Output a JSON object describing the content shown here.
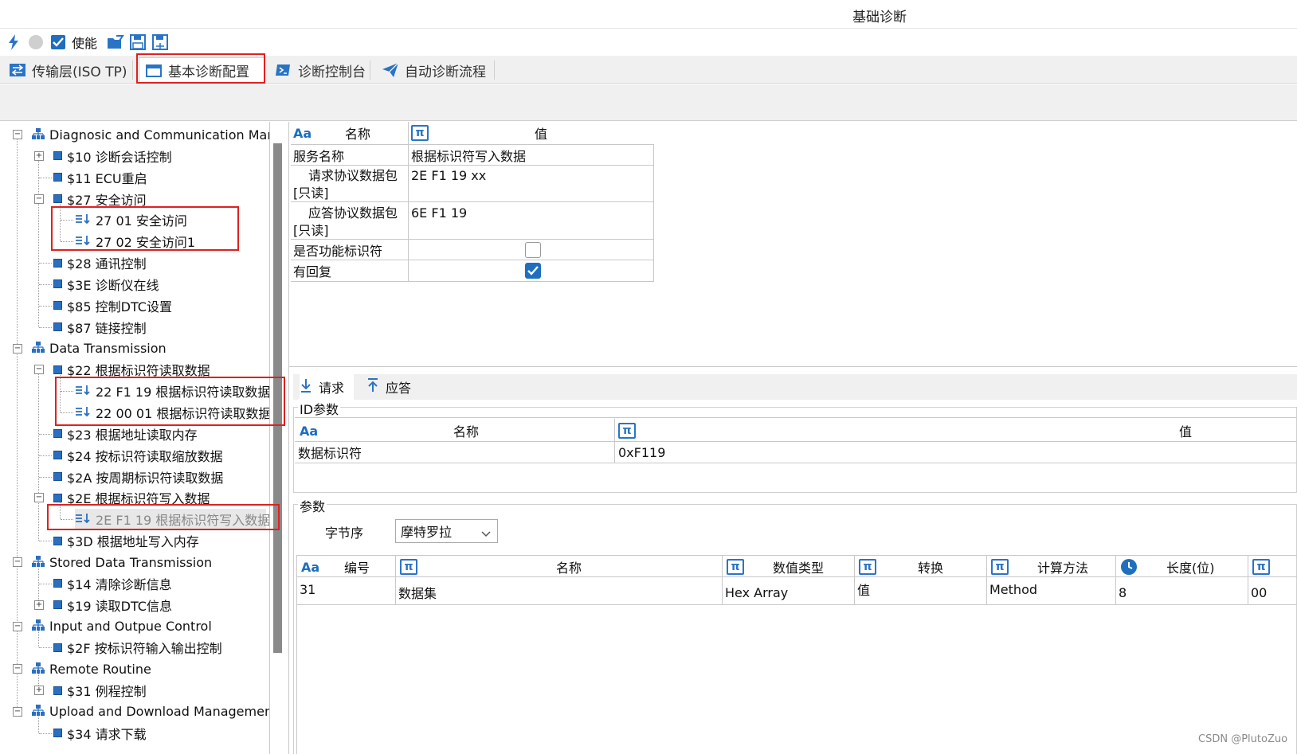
{
  "window": {
    "title": "基础诊断"
  },
  "toolbar": {
    "enable_label": "使能"
  },
  "tabs": [
    {
      "label": "传输层(ISO TP)"
    },
    {
      "label": "基本诊断配置"
    },
    {
      "label": "诊断控制台"
    },
    {
      "label": "自动诊断流程"
    }
  ],
  "tree": {
    "nodes": [
      {
        "label": "Diagnosic and Communication Manag"
      },
      {
        "label": "$10 诊断会话控制"
      },
      {
        "label": "$11 ECU重启"
      },
      {
        "label": "$27 安全访问"
      },
      {
        "label": "27 01 安全访问"
      },
      {
        "label": "27 02 安全访问1"
      },
      {
        "label": "$28 通讯控制"
      },
      {
        "label": "$3E 诊断仪在线"
      },
      {
        "label": "$85 控制DTC设置"
      },
      {
        "label": "$87 链接控制"
      },
      {
        "label": "Data Transmission"
      },
      {
        "label": "$22 根据标识符读取数据"
      },
      {
        "label": "22 F1 19 根据标识符读取数据"
      },
      {
        "label": "22 00 01 根据标识符读取数据"
      },
      {
        "label": "$23 根据地址读取内存"
      },
      {
        "label": "$24 按标识符读取缩放数据"
      },
      {
        "label": "$2A 按周期标识符读取数据"
      },
      {
        "label": "$2E 根据标识符写入数据"
      },
      {
        "label": "2E F1 19 根据标识符写入数据"
      },
      {
        "label": "$3D 根据地址写入内存"
      },
      {
        "label": "Stored Data Transmission"
      },
      {
        "label": "$14 清除诊断信息"
      },
      {
        "label": "$19 读取DTC信息"
      },
      {
        "label": "Input and Outpue Control"
      },
      {
        "label": "$2F 按标识符输入输出控制"
      },
      {
        "label": "Remote Routine"
      },
      {
        "label": "$31 例程控制"
      },
      {
        "label": "Upload and Download Management"
      },
      {
        "label": "$34 请求下载"
      }
    ]
  },
  "props": {
    "header_name": "名称",
    "header_value": "值",
    "icon_text": "Aa",
    "rows": [
      {
        "name": "服务名称",
        "value": "根据标识符写入数据"
      },
      {
        "name_line1": "请求协议数据包",
        "name_line2": "[只读]",
        "value": "2E F1 19 xx"
      },
      {
        "name_line1": "应答协议数据包",
        "name_line2": "[只读]",
        "value": "6E F1 19"
      },
      {
        "name": "是否功能标识符",
        "checked": false
      },
      {
        "name": "有回复",
        "checked": true
      }
    ]
  },
  "subtabs": {
    "request": "请求",
    "response": "应答"
  },
  "id_params": {
    "group_title": "ID参数",
    "header_name": "名称",
    "header_value": "值",
    "row": {
      "name": "数据标识符",
      "value": "0xF119"
    }
  },
  "params": {
    "group_title": "参数",
    "byte_order_label": "字节序",
    "byte_order_value": "摩特罗拉",
    "columns": [
      "编号",
      "名称",
      "数值类型",
      "转换",
      "计算方法",
      "长度(位)"
    ],
    "row": [
      "31",
      "数据集",
      "Hex Array",
      "值",
      "Method",
      "8",
      "00"
    ]
  },
  "watermark": "CSDN @PlutoZuo"
}
